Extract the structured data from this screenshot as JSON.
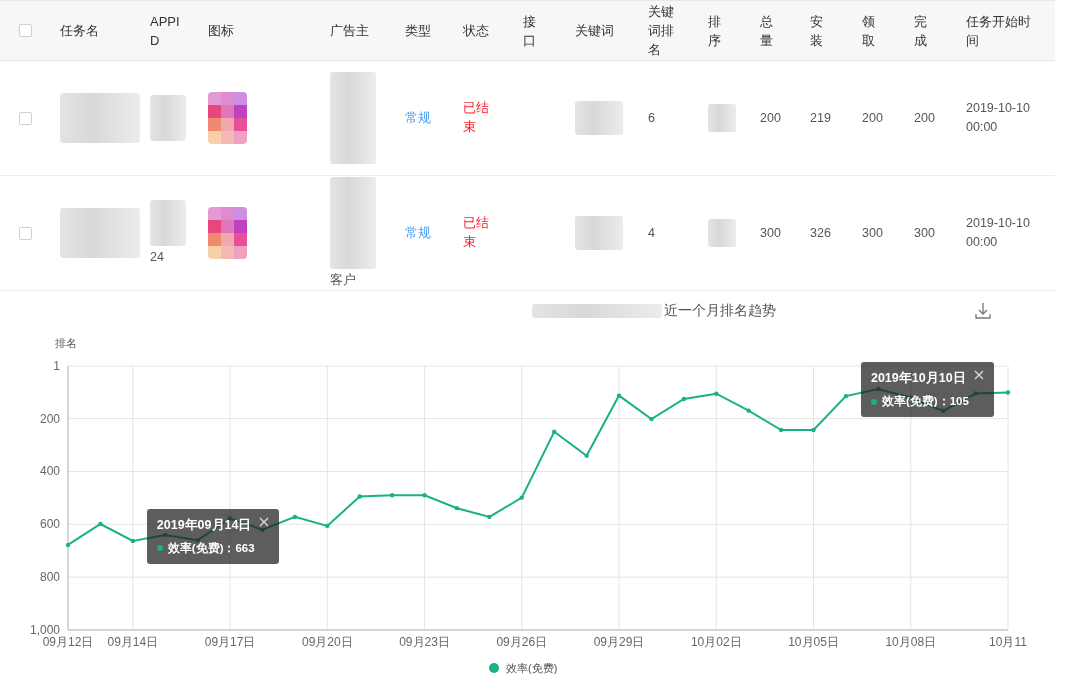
{
  "table": {
    "header_checkbox": {
      "checked": false
    },
    "columns": [
      "任务名",
      "APPID",
      "图标",
      "广告主",
      "类型",
      "状态",
      "接口",
      "关键词",
      "关键词排名",
      "排序",
      "总量",
      "安装",
      "领取",
      "完成",
      "任务开始时间"
    ],
    "rows": [
      {
        "checked": false,
        "type": "常规",
        "status": "已结束",
        "keyword_rank": "6",
        "total": "200",
        "installed": "219",
        "claimed": "200",
        "completed": "200",
        "start_time": "2019-10-10 00:00"
      },
      {
        "checked": false,
        "appid": "24",
        "advertiser": "客户",
        "type": "常规",
        "status": "已结束",
        "keyword_rank": "4",
        "total": "300",
        "installed": "326",
        "claimed": "300",
        "completed": "300",
        "start_time": "2019-10-10 00:00"
      }
    ]
  },
  "chart": {
    "title": "近一个月排名趋势",
    "chart_data": {
      "type": "line",
      "ylabel": "排名",
      "categories": [
        "09月12日",
        null,
        "09月14日",
        null,
        null,
        "09月17日",
        null,
        null,
        "09月20日",
        null,
        null,
        "09月23日",
        null,
        null,
        "09月26日",
        null,
        null,
        "09月29日",
        null,
        null,
        "10月02日",
        null,
        null,
        "10月05日",
        null,
        null,
        "10月08日",
        null,
        null,
        "10月11"
      ],
      "series": [
        {
          "name": "效率(免费)",
          "color": "#19b08a",
          "values": [
            678,
            599,
            663,
            640,
            660,
            578,
            621,
            572,
            606,
            495,
            490,
            490,
            539,
            572,
            499,
            250,
            341,
            113,
            202,
            126,
            106,
            170,
            243,
            243,
            115,
            88,
            121,
            171,
            105,
            101
          ]
        }
      ],
      "ylim": [
        1000,
        1
      ],
      "yticks": [
        1,
        200,
        400,
        600,
        800,
        {
          "value": 1000,
          "label": "1,000"
        }
      ],
      "grid": true
    },
    "tooltips": [
      {
        "title": "2019年09月14日",
        "text": "效率(免费)：663"
      },
      {
        "title": "2019年10月10日",
        "text": "效率(免费)：105"
      }
    ]
  }
}
